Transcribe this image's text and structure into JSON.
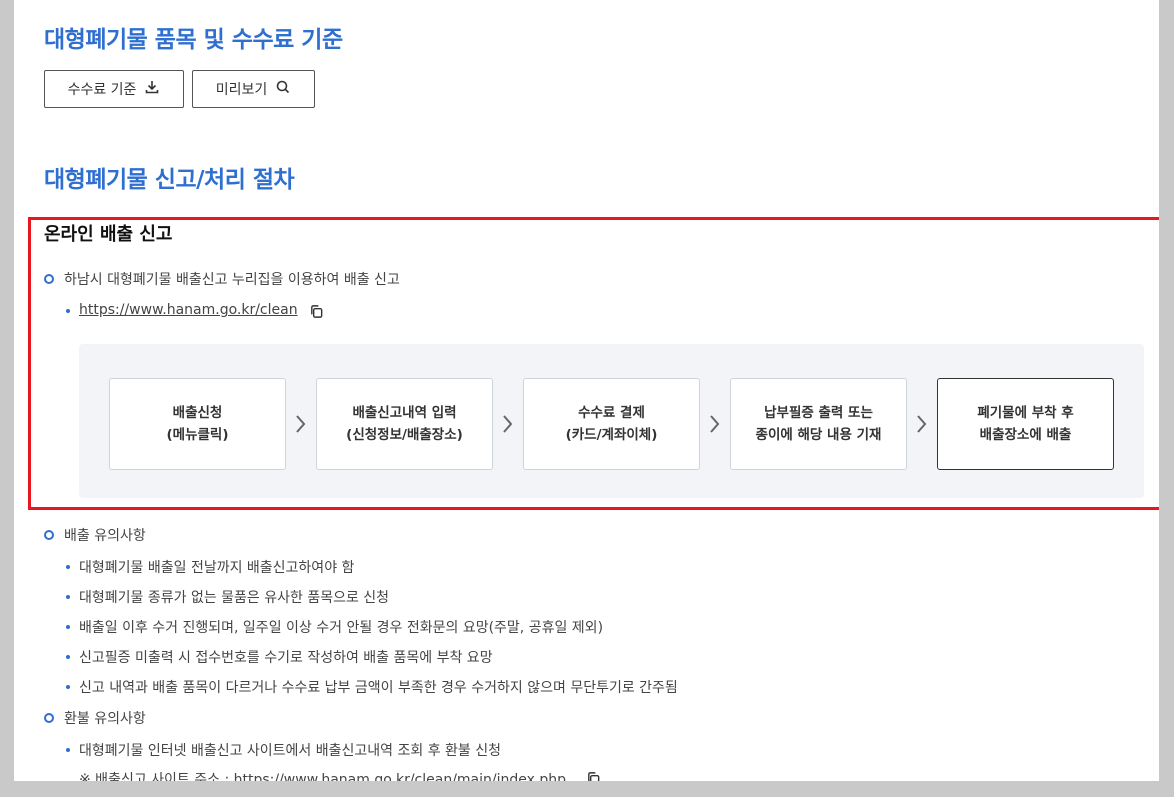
{
  "section1": {
    "title": "대형폐기물 품목 및 수수료 기준",
    "fee_button": "수수료 기준",
    "preview_button": "미리보기"
  },
  "section2": {
    "title": "대형폐기물 신고/처리 절차",
    "online_title": "온라인 배출 신고",
    "online_desc": "하남시 대형폐기물 배출신고 누리집을 이용하여 배출 신고",
    "online_link": "https://www.hanam.go.kr/clean",
    "steps": [
      {
        "line1": "배출신청",
        "line2": "(메뉴클릭)"
      },
      {
        "line1": "배출신고내역 입력",
        "line2": "(신청정보/배출장소)"
      },
      {
        "line1": "수수료 결제",
        "line2": "(카드/계좌이체)"
      },
      {
        "line1": "납부필증 출력 또는",
        "line2": "종이에 해당 내용 기재"
      },
      {
        "line1": "폐기물에 부착 후",
        "line2": "배출장소에 배출"
      }
    ]
  },
  "notes": {
    "title": "배출 유의사항",
    "items": [
      "대형폐기물 배출일 전날까지 배출신고하여야 함",
      "대형폐기물 종류가 없는 물품은 유사한 품목으로 신청",
      "배출일 이후 수거 진행되며, 일주일 이상 수거 안될 경우 전화문의 요망(주말, 공휴일 제외)",
      "신고필증 미출력 시 접수번호를 수기로 작성하여 배출 품목에 부착 요망",
      "신고 내역과 배출 품목이 다르거나 수수료 납부 금액이 부족한 경우 수거하지 않으며 무단투기로 간주됨"
    ]
  },
  "refund": {
    "title": "환불 유의사항",
    "item": "대형폐기물 인터넷 배출신고 사이트에서 배출신고내역 조회 후 환불 신청",
    "site_prefix": "※ 배출신고 사이트 주소 : ",
    "site_link": "https://www.hanam.go.kr/clean/main/index.php"
  },
  "colors": {
    "accent": "#2f6fd0",
    "highlight": "#e8161e"
  }
}
